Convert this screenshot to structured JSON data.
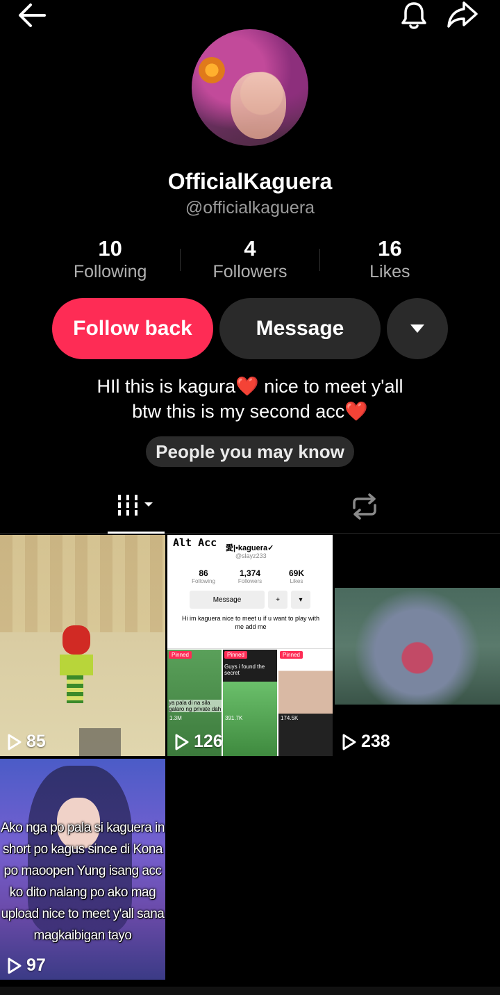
{
  "topbar": {
    "back_icon": "arrow-left-icon",
    "bell_icon": "bell-icon",
    "share_icon": "share-icon"
  },
  "profile": {
    "display_name": "OfficialKaguera",
    "handle": "@officialkaguera",
    "stats": [
      {
        "value": "10",
        "label": "Following"
      },
      {
        "value": "4",
        "label": "Followers"
      },
      {
        "value": "16",
        "label": "Likes"
      }
    ],
    "follow_label": "Follow back",
    "message_label": "Message",
    "bio_line1": "HIl this is kagura",
    "bio_line1_end": " nice to meet y'all",
    "bio_line2": "btw this is my second acc",
    "heart": "❤️",
    "pymk_label": "People you may know"
  },
  "colors": {
    "accent": "#fe2c55",
    "button_dark": "#2a2a2a",
    "heart": "#e8352f"
  },
  "videos": [
    {
      "views": "85"
    },
    {
      "views": "126",
      "mini": {
        "alt_acc": "Alt Acc",
        "name": "愛|•kaguera✓",
        "username": "@slayz233",
        "stats": [
          {
            "value": "86",
            "label": "Following"
          },
          {
            "value": "1,374",
            "label": "Followers"
          },
          {
            "value": "69K",
            "label": "Likes"
          }
        ],
        "message": "Message",
        "bio": "Hi im kaguera nice to meet u if u want to play with me add me",
        "pinned": "Pinned",
        "thumb1_caption": "ya pala di na sila galaro ng private dah",
        "thumb2_caption": "Guys i found the secret",
        "thumb1_views": "1.3M",
        "thumb2_views": "391.7K",
        "thumb3_views": "174.5K"
      }
    },
    {
      "views": "238"
    },
    {
      "views": "97",
      "caption": "Ako nga po pala si kaguera in short po kagus since di Kona po maoopen Yung isang acc ko dito nalang po ako mag upload nice to meet y'all sana magkaibigan tayo"
    }
  ]
}
